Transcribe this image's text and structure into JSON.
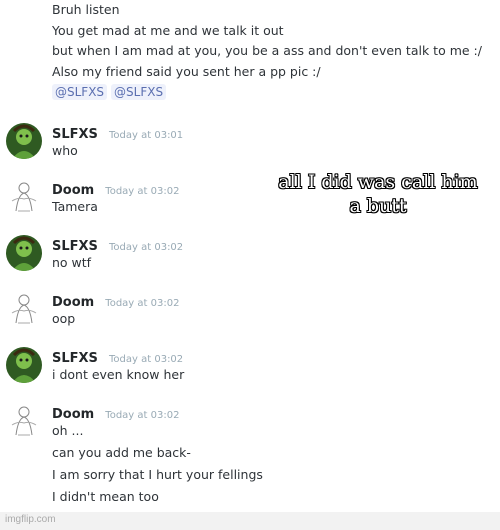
{
  "top_message": {
    "lines": [
      "Bruh listen",
      "You get mad at me and we talk it out",
      "but when I am mad at you, you be a ass and don't even talk to me :/",
      "Also my friend said you sent her a pp pic :/"
    ],
    "mentions": [
      "@SLFXS",
      "@SLFXS"
    ]
  },
  "messages": [
    {
      "username": "SLFXS",
      "timestamp": "Today at 03:01",
      "lines": [
        "who"
      ]
    },
    {
      "username": "Doom",
      "timestamp": "Today at 03:02",
      "lines": [
        "Tamera"
      ]
    },
    {
      "username": "SLFXS",
      "timestamp": "Today at 03:02",
      "lines": [
        "no wtf"
      ]
    },
    {
      "username": "Doom",
      "timestamp": "Today at 03:02",
      "lines": [
        "oop"
      ]
    },
    {
      "username": "SLFXS",
      "timestamp": "Today at 03:02",
      "lines": [
        "i dont even know her"
      ]
    },
    {
      "username": "Doom",
      "timestamp": "Today at 03:02",
      "lines": [
        "oh ...",
        "can you add me back-",
        "I am sorry that I hurt your fellings",
        "I didn't mean too"
      ]
    }
  ],
  "overlay_caption": "all I did was call him a butt",
  "watermark": "imgflip.com",
  "colors": {
    "mention_text": "#5b6fb0",
    "mention_bg": "#eef1fb",
    "timestamp": "#99aab5",
    "text": "#2e3338"
  },
  "avatars": {
    "SLFXS": "green-character-avatar",
    "Doom": "sketch-figure-avatar"
  }
}
